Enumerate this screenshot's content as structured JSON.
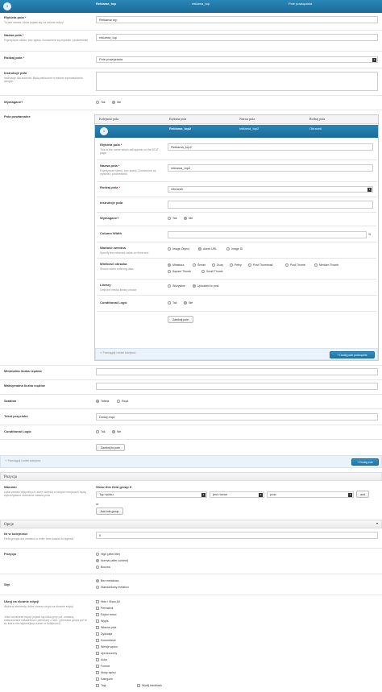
{
  "top": {
    "num": "3",
    "label": "Reklama_top",
    "name": "reklama_top",
    "type": "Pole powiązania"
  },
  "f1": {
    "label": "Etykieta pola",
    "desc": "To jest nazwa, która pojawi się na stronie edycji",
    "value": "Reklama top"
  },
  "f2": {
    "label": "Nazwa pola",
    "desc": "Pojedyncze słowo, bez spacji. Dozwolone są myślniki i podkreślniki",
    "value": "reklama_top"
  },
  "f3": {
    "label": "Rodzaj pola",
    "value": "Pole powiązania"
  },
  "f4": {
    "label": "Instrukcje pola",
    "desc": "Instrukcje dla autorów. Będą widoczne w trakcie wprowadzania danych"
  },
  "f5": {
    "label": "Wymagane?",
    "opts": [
      "Tak",
      "Nie"
    ]
  },
  "f6": {
    "label": "Pola powtarzalne"
  },
  "sub": {
    "headers": [
      "Kolejność pola",
      "Etykieta pola",
      "Nazwa pola",
      "Rodzaj pola"
    ],
    "row": {
      "num": "1",
      "label": "Reklama_top2",
      "name": "reklama_top2",
      "type": "Obrazek"
    },
    "s1": {
      "label": "Etykieta pola",
      "desc": "This is the name which will appear on the EDIT page",
      "value": "Reklama_top2"
    },
    "s2": {
      "label": "Nazwa pola",
      "desc": "Pojedyncze słowo, bez spacji. Dozwolone są myślniki i podkreślniki",
      "value": "reklama_top2"
    },
    "s3": {
      "label": "Rodzaj pola",
      "value": "Obrazek"
    },
    "s4": {
      "label": "Instrukcje pola"
    },
    "s5": {
      "label": "Wymagane?",
      "opts": [
        "Tak",
        "Nie"
      ]
    },
    "s6": {
      "label": "Column Width",
      "unit": "%"
    },
    "s7": {
      "label": "Wartość zwrotna",
      "desc": "Specify the returned value on front end",
      "opts": [
        "Image Object",
        "Adres URL",
        "Image ID"
      ]
    },
    "s8": {
      "label": "Wielkość obrazka",
      "desc": "Shown when entering data",
      "opts": [
        "Miniatura",
        "Średni",
        "Duży",
        "Pełny",
        "Post Thumbnail",
        "Post Thumb",
        "Medium Thumb",
        "Square Thumb",
        "Small Thumb"
      ]
    },
    "s9": {
      "label": "Library",
      "desc": "Limit the media library choice",
      "opts": [
        "Wszystkie",
        "Uploaded to post"
      ]
    },
    "s10": {
      "label": "Conditional Logic",
      "opts": [
        "Tak",
        "Nie"
      ]
    },
    "close": "Zamknij pole",
    "hint": "Przeciągnij i zmień kolejność",
    "add": "+ Dodaj pole podrzędne"
  },
  "f7": {
    "label": "Minimalna liczba rzędów"
  },
  "f8": {
    "label": "Maksymalna liczba rzędów"
  },
  "f9": {
    "label": "Szablon",
    "opts": [
      "Tabela",
      "Rząd"
    ]
  },
  "f10": {
    "label": "Tekst przycisku",
    "value": "Dodaj rząd"
  },
  "f11": {
    "label": "Conditional Logic",
    "opts": [
      "Tak",
      "Nie"
    ]
  },
  "close": "Zamknij to pole",
  "hint": "Przeciągnij i zmień kolejność",
  "add": "+ Dodaj pole",
  "pozycja": {
    "title": "Pozycja",
    "label": "Warunki",
    "desc": "Ustal zestaw wytycznych, które określą w których miejscach będą wykorzystane określone własne pola",
    "rule_title": "Show this field group if",
    "param": "Typ wpisu",
    "op": "jest równe",
    "value": "post",
    "and": "and",
    "or": "or",
    "add_group": "Add rule group"
  },
  "opcje": {
    "title": "Opcje",
    "order": {
      "label": "Nr w kolejności",
      "desc": "Field groups are created in order from lowest to highest",
      "value": "0"
    },
    "pos": {
      "label": "Pozycja",
      "opts": [
        "High (after title)",
        "Normal (after content)",
        "Boczna"
      ]
    },
    "styl": {
      "label": "Styl",
      "opts": [
        "Bez metaboxa",
        "Standardowy metabox"
      ]
    },
    "hide": {
      "label": "Ukryj na ekranie edycji",
      "desc1": "Wybierz elementy, które chcesz ukryć na ekranie edycji.",
      "desc2": "Jeśli na ekranie edycji pojawi się kilka grup pól, zostaną zastosowane ustawienia z pierwszej z nich. (pierwsza grupa pól to ta, która ma najmniejszy numer w kolejności)",
      "items": [
        "Hide / Show All",
        "Permalink",
        "Edytor treści",
        "Wypis",
        "Własne pola",
        "Dyskusja",
        "Komentarze",
        "Wersje wpisu",
        "Uproszczony",
        "Autor",
        "Format",
        "Nowy wpisu",
        "Kategorie",
        "Tagi",
        "Wyślij trackback"
      ]
    }
  }
}
